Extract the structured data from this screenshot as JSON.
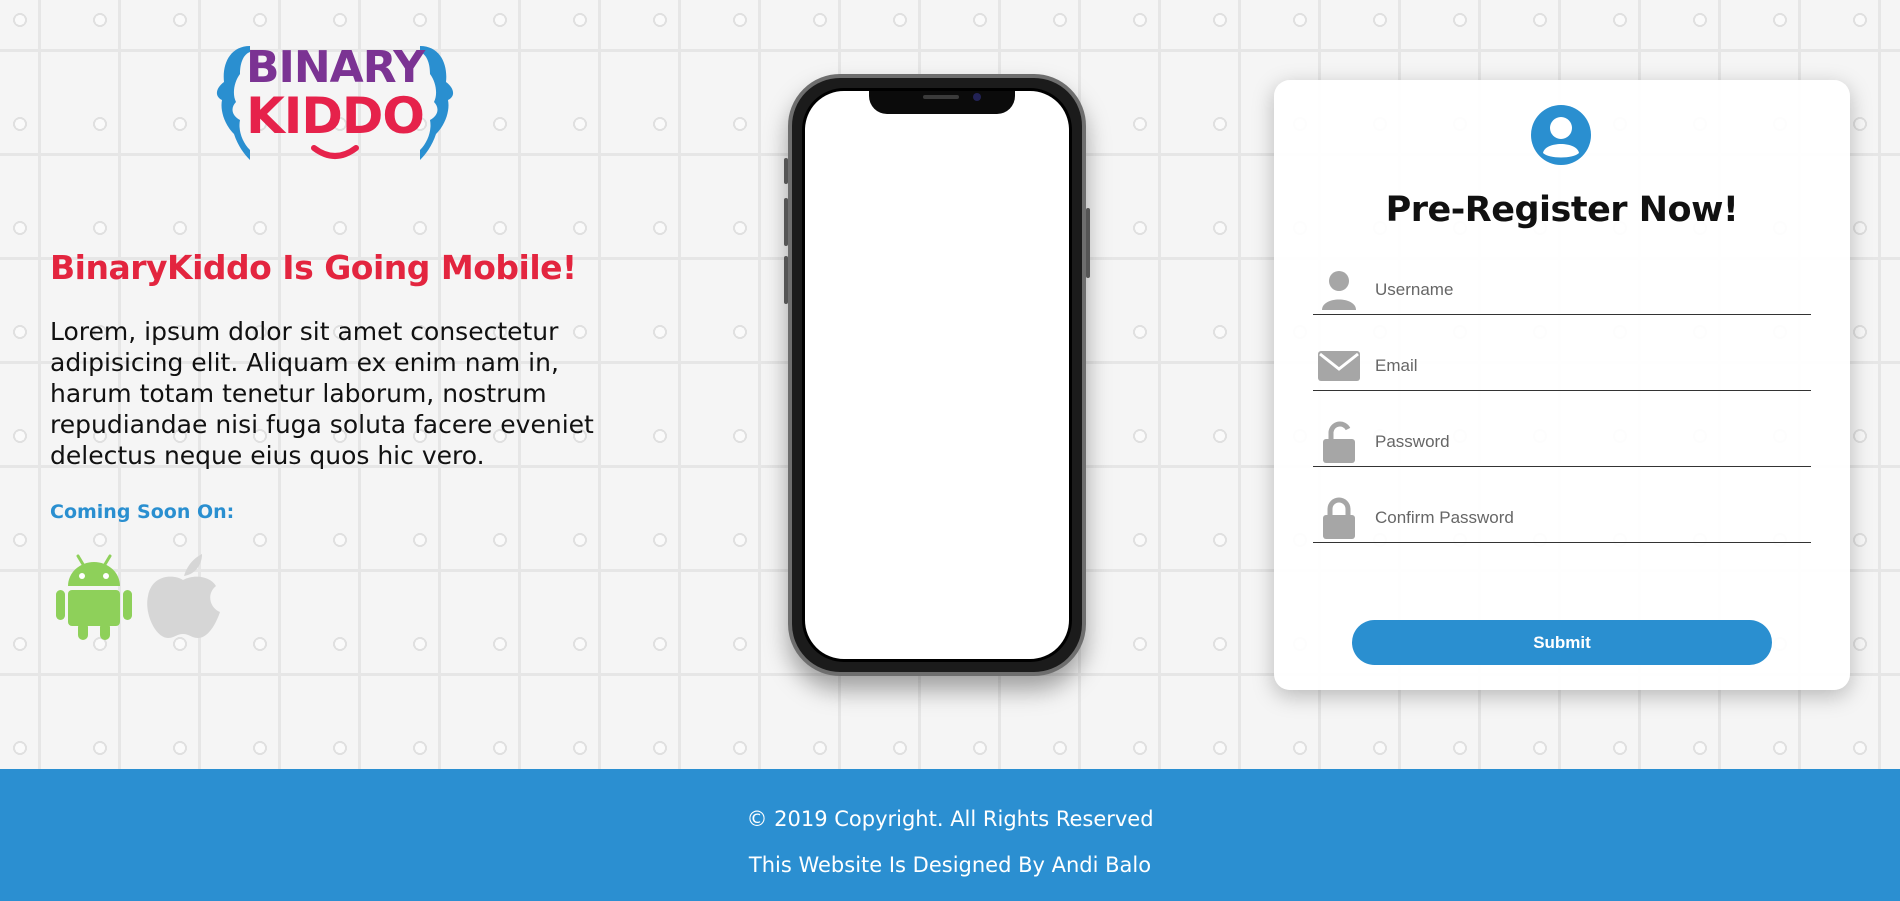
{
  "brand": {
    "logo_line1": "BINARY",
    "logo_line2": "KIDDO",
    "colors": {
      "purple": "#7b3393",
      "red": "#e6224b",
      "blue": "#2a8fd0"
    }
  },
  "hero": {
    "headline": "BinaryKiddo Is Going Mobile!",
    "body": "Lorem, ipsum dolor sit amet consectetur adipisicing elit. Aliquam ex enim nam in, harum totam tenetur laborum, nostrum repudiandae nisi fuga soluta facere eveniet delectus neque eius quos hic vero.",
    "coming_soon": "Coming Soon On:",
    "stores": [
      "android-icon",
      "apple-icon"
    ]
  },
  "form": {
    "title": "Pre-Register Now!",
    "username_placeholder": "Username",
    "email_placeholder": "Email",
    "password_placeholder": "Password",
    "confirm_placeholder": "Confirm Password",
    "submit_label": "Submit"
  },
  "footer": {
    "copyright": "© 2019 Copyright. All Rights Reserved",
    "credit": "This Website Is Designed By Andi Balo"
  }
}
